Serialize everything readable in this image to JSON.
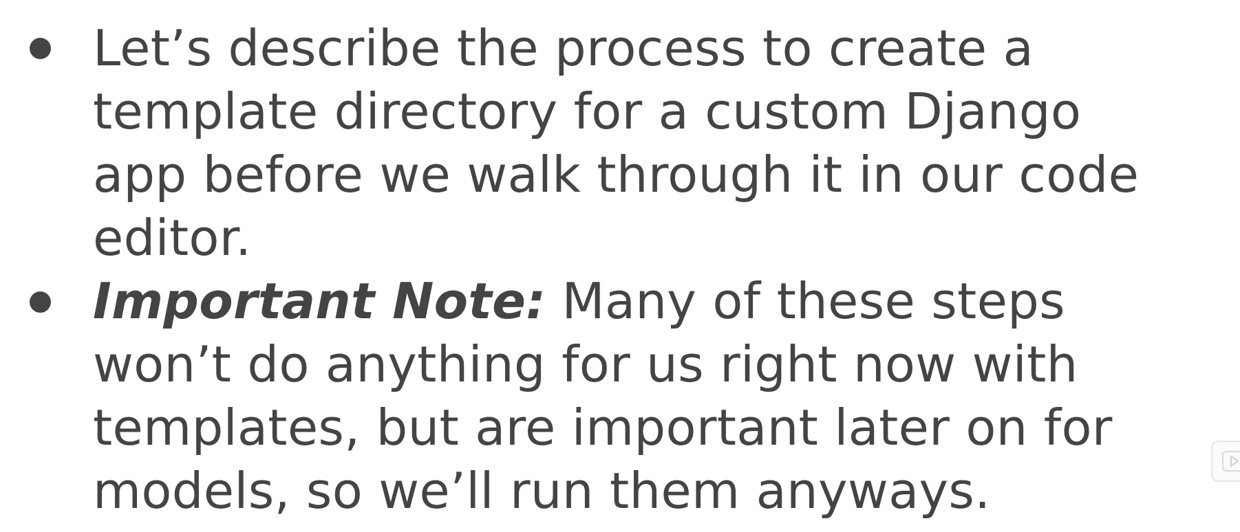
{
  "slide": {
    "bullets": [
      {
        "lines": [
          "Let’s describe the process to create a",
          "template directory for a custom Django",
          "app before we walk through it in our code",
          "editor."
        ]
      },
      {
        "label": "Important Note:",
        "first_line_rest": " Many of these steps",
        "lines": [
          "won’t do anything for us right now with",
          "templates, but are important later on for",
          "models, so we’ll run them anyways."
        ]
      }
    ]
  },
  "player": {
    "icon": "play-icon"
  },
  "colors": {
    "text": "#444444",
    "background": "#ffffff"
  }
}
